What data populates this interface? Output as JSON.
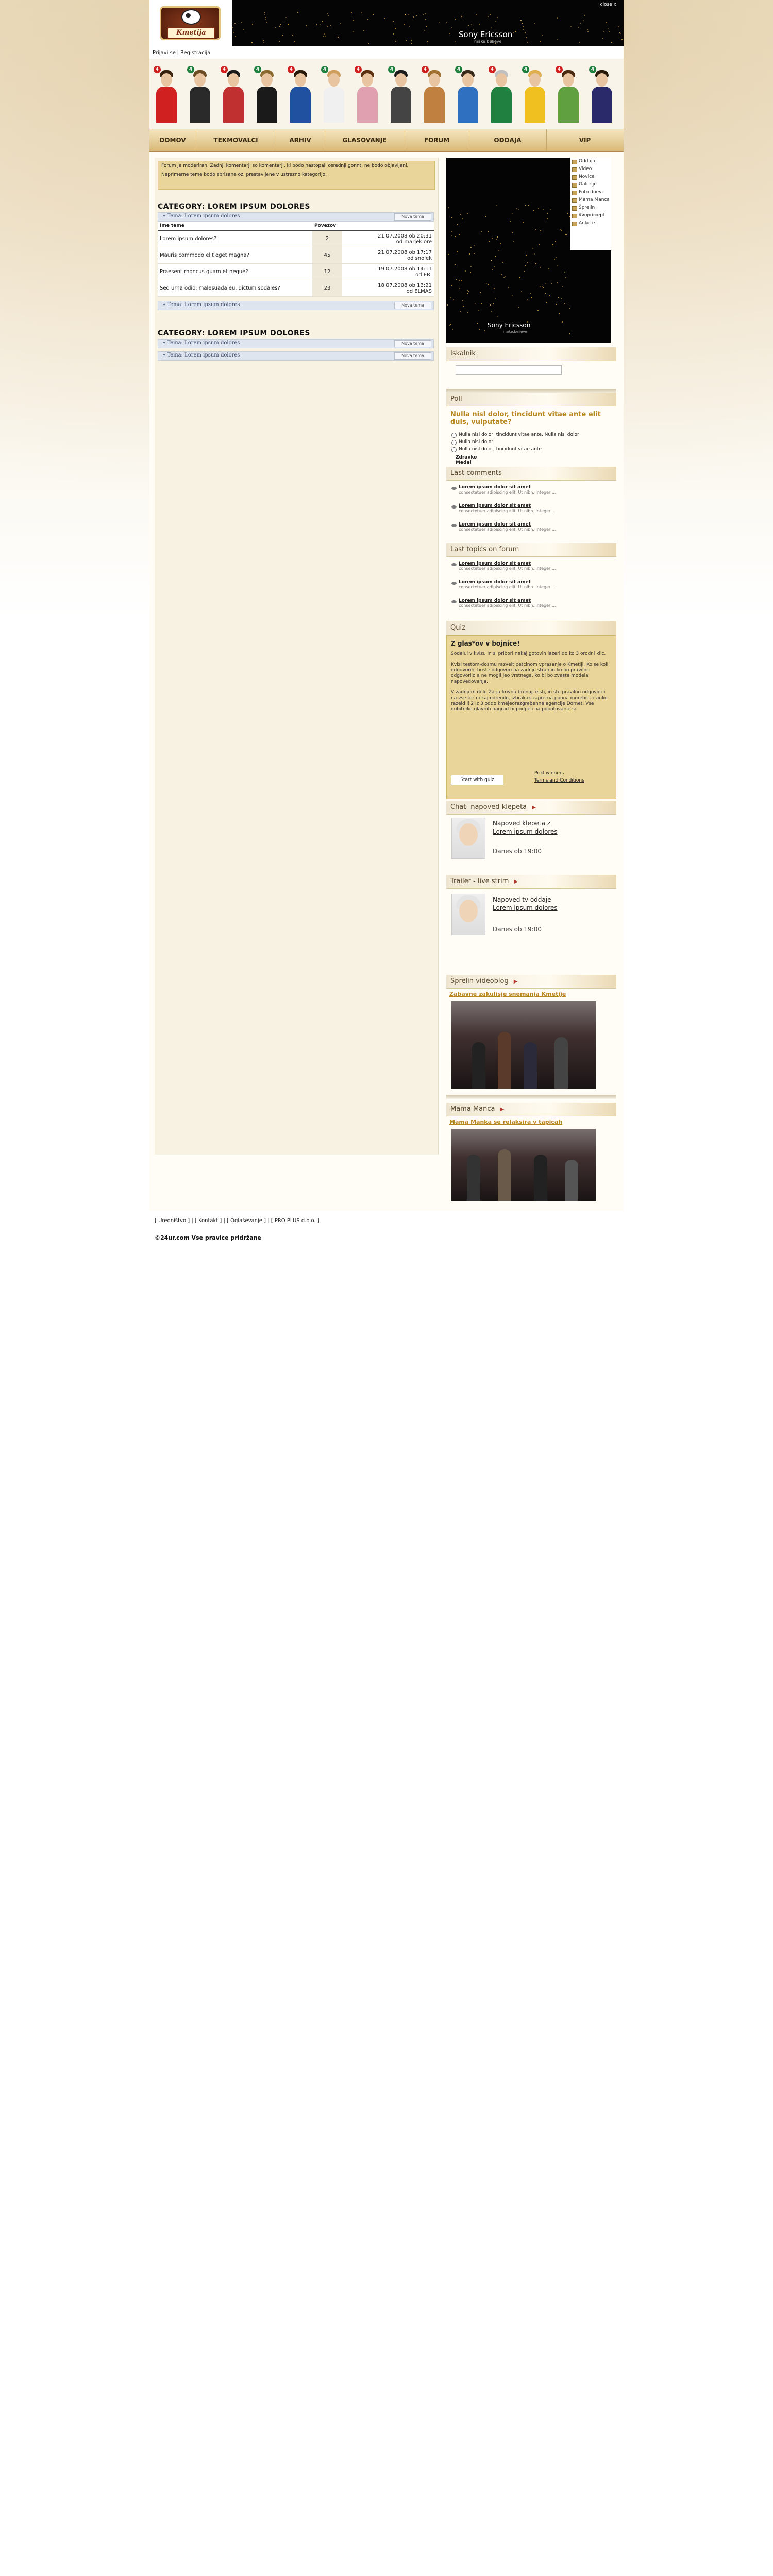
{
  "header": {
    "logo_text": "Kmetija",
    "banner_brand": "Sony Ericsson",
    "banner_sub": "make.believe",
    "banner_close": "close x"
  },
  "login": {
    "login_label": "Prijavi se",
    "register_label": "Registracija"
  },
  "contestants_badges": [
    "4",
    "4",
    "4",
    "4",
    "4",
    "4",
    "4",
    "4",
    "4",
    "4",
    "4",
    "4",
    "4",
    "4"
  ],
  "nav": [
    "DOMOV",
    "TEKMOVALCI",
    "ARHIV",
    "GLASOVANJE",
    "FORUM",
    "ODDAJA",
    "VIP"
  ],
  "notice": {
    "line1": "Forum je moderiran. Zadnji komentarji so komentarji, ki bodo nastopali osrednji gonnt, ne bodo objavljeni.",
    "line2": "Neprimerne teme bodo zbrisane oz. prestavljene v ustrezno kategorijo."
  },
  "category1": {
    "title": "CATEGORY: LOREM IPSUM DOLORES",
    "crumb": "» Tema: Lorem ipsum dolores",
    "new_topic": "Nova tema",
    "headers": {
      "topic": "Ime teme",
      "replies": "Povezov",
      "last": ""
    },
    "rows": [
      {
        "title": "Lorem ipsum dolores?",
        "replies": "2",
        "last1": "21.07.2008 ob 20:31",
        "last2": "od marjeklore"
      },
      {
        "title": "Mauris commodo elit eget magna?",
        "replies": "45",
        "last1": "21.07.2008 ob 17:17",
        "last2": "od snolek"
      },
      {
        "title": "Praesent rhoncus quam et neque?",
        "replies": "12",
        "last1": "19.07.2008 ob 14:11",
        "last2": "od ERI"
      },
      {
        "title": "Sed urna odio, malesuada eu, dictum sodales?",
        "replies": "23",
        "last1": "18.07.2008 ob 13:21",
        "last2": "od ELMAS"
      }
    ],
    "crumb_bottom": "» Tema: Lorem ipsum dolores"
  },
  "category2": {
    "title": "CATEGORY: LOREM IPSUM DOLORES",
    "crumb": "» Tema: Lorem ipsum dolores",
    "crumb2": "» Tema: Lorem ipsum dolores",
    "new_topic": "Nova tema"
  },
  "video_menu": [
    "Oddaja",
    "Video",
    "Novice",
    "Galerije",
    "Foto dnevi",
    "Mama Manca",
    "Šprelin videoblog",
    "Tvoj recept",
    "Ankete"
  ],
  "video": {
    "brand": "Sony Ericsson",
    "sub": "make.believe"
  },
  "search": {
    "title": "Iskalnik",
    "placeholder": ""
  },
  "poll": {
    "title": "Poll",
    "question": "Nulla nisl dolor, tincidunt vitae ante elit duis, vulputate?",
    "options": [
      "Nulla nisl dolor, tincidunt vitae ante. Nulla nisl dolor",
      "Nulla nisl dolor",
      "Nulla nisl dolor, tincidunt vitae ante"
    ],
    "links": [
      "Zdravko",
      "Medel"
    ]
  },
  "last_comments": {
    "title": "Last comments",
    "items": [
      {
        "link": "Lorem ipsum dolor sit amet",
        "text": "consectetuer adipiscing elit. Ut nibh. Integer ..."
      },
      {
        "link": "Lorem ipsum dolor sit amet",
        "text": "consectetuer adipiscing elit. Ut nibh. Integer ..."
      },
      {
        "link": "Lorem ipsum dolor sit amet",
        "text": "consectetuer adipiscing elit. Ut nibh. Integer ..."
      }
    ]
  },
  "last_topics": {
    "title": "Last topics on forum",
    "items": [
      {
        "link": "Lorem ipsum dolor sit amet",
        "text": "consectetuer adipiscing elit. Ut nibh. Integer ..."
      },
      {
        "link": "Lorem ipsum dolor sit amet",
        "text": "consectetuer adipiscing elit. Ut nibh. Integer ..."
      },
      {
        "link": "Lorem ipsum dolor sit amet",
        "text": "consectetuer adipiscing elit. Ut nibh. Integer ..."
      }
    ]
  },
  "quiz": {
    "title": "Quiz",
    "heading": "Z glas*ov v bojnice!",
    "p1": "Sodelui v kvizu in si pribori nekaj gotovih lazeri do ko 3 orodni klic.",
    "p2": "Kvizi testom-dosmu razvelt petcinom vprasanje o Kmetiji. Ko se koli odgovorih, boste odgovori na zadnju stran in ko bo pravilno odgovorilo a ne mogli jeo vrstnega, ko bi bo zvesta modela napovedovanja.",
    "p3": "V zadnjem delu Zarja krivnu bronaji eish, in ste pravilno odgovorili na vse ter nekaj odrenilo, izbrakak zapretna poona morebit - iranko razeld il 2 iz 3 oddo kmejeorazgrebenne agencije Dornet. Vse dobitnike glavnih nagrad bi podpeli na popotovanje.si",
    "start": "Start with quiz",
    "prev": "Prikl winners",
    "terms": "Terms and Conditions"
  },
  "chat": {
    "title": "Chat- napoved klepeta",
    "line1": "Napoved klepeta z",
    "link": "Lorem ipsum dolores",
    "time": "Danes ob 19:00"
  },
  "trailer": {
    "title": "Trailer - live strim",
    "line1": "Napoved tv oddaje",
    "link": "Lorem ipsum dolores",
    "time": "Danes ob 19:00"
  },
  "videoblog": {
    "title": "Šprelin videoblog",
    "link": "Zabavne zakulisje snemanja Kmetije"
  },
  "mama": {
    "title": "Mama Manca",
    "link": "Mama Manka se relaksira v tapicah"
  },
  "footer": {
    "links": "[ Uredništvo ] | [ Kontakt ] | [ Oglaševanje ] | [ PRO PLUS d.o.o. ]",
    "copy": "©24ur.com Vse pravice pridržane"
  },
  "colors": {
    "accent": "#b7861f",
    "nav_bg": "#d9b978",
    "notice_bg": "#e9d49a"
  }
}
